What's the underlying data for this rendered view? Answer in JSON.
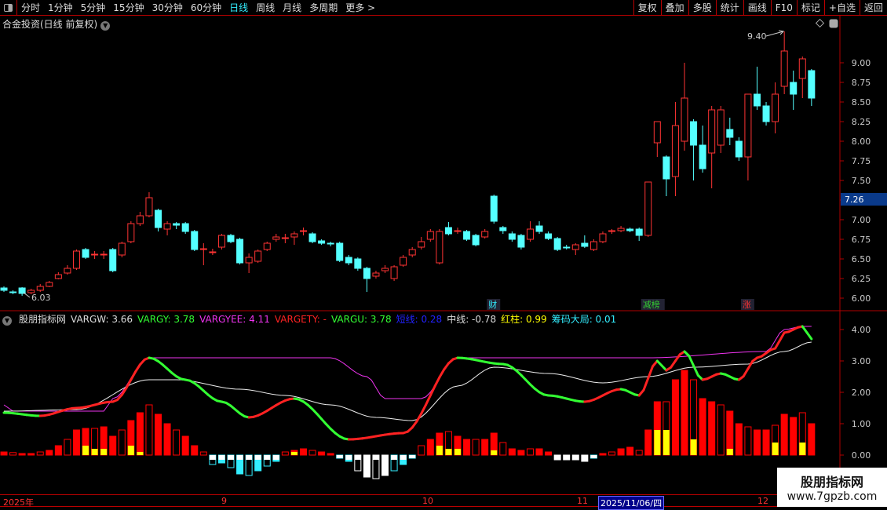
{
  "topbar": {
    "periods": [
      "分时",
      "1分钟",
      "5分钟",
      "15分钟",
      "30分钟",
      "60分钟",
      "日线",
      "周线",
      "月线",
      "多周期",
      "更多 >"
    ],
    "active": "日线",
    "right_buttons": [
      "复权",
      "叠加",
      "多股",
      "统计",
      "画线",
      "F10",
      "标记",
      "+自选",
      "返回"
    ]
  },
  "title": "合金投资(日线 前复权)",
  "price_axis": {
    "labels": [
      "9.00",
      "8.75",
      "8.50",
      "8.25",
      "8.00",
      "7.75",
      "7.50",
      "7.25",
      "7.00",
      "6.75",
      "6.50",
      "6.25",
      "6.00"
    ],
    "current": "7.26",
    "high_label": "9.40",
    "low_label": "6.03"
  },
  "markers": [
    {
      "text": "财",
      "color": "#3ef",
      "index": 54
    },
    {
      "text": "减榜",
      "color": "#3c3",
      "index": 71
    },
    {
      "text": "涨",
      "color": "#f33",
      "index": 82
    }
  ],
  "indicator": {
    "name": "股朋指标网",
    "items": [
      {
        "text": "VARGW: 3.66",
        "color": "#ddd"
      },
      {
        "text": "VARGY: 3.78",
        "color": "#3f3"
      },
      {
        "text": "VARGYEE: 4.11",
        "color": "#e3e"
      },
      {
        "text": "VARGETY: -",
        "color": "#f22"
      },
      {
        "text": "VARGU: 3.78",
        "color": "#3f3"
      },
      {
        "text": "短线: 0.28",
        "color": "#22f"
      },
      {
        "text": "中线: -0.78",
        "color": "#ddd"
      },
      {
        "text": "红柱: 0.99",
        "color": "#ff0"
      },
      {
        "text": "筹码大局: 0.01",
        "color": "#3ef"
      }
    ],
    "axis": [
      "4.00",
      "3.00",
      "2.00",
      "1.00",
      "0.00"
    ]
  },
  "dates": {
    "labels": [
      "2025年",
      "9",
      "10",
      "11",
      "2025/11/06/四",
      "12"
    ]
  },
  "watermark": {
    "line1": "股朋指标网",
    "line2": "www.7gpzb.com"
  },
  "colors": {
    "up": "#ff3333",
    "down": "#54ffff",
    "grid": "#b00000"
  },
  "chart_data": {
    "type": "candlestick",
    "price_range": [
      5.9,
      9.5
    ],
    "candles": [
      [
        6.13,
        6.1,
        6.15,
        6.08
      ],
      [
        6.08,
        6.07,
        6.1,
        6.05
      ],
      [
        6.13,
        6.06,
        6.14,
        6.03
      ],
      [
        6.07,
        6.1,
        6.12,
        6.05
      ],
      [
        6.1,
        6.15,
        6.18,
        6.08
      ],
      [
        6.15,
        6.2,
        6.22,
        6.14
      ],
      [
        6.25,
        6.3,
        6.33,
        6.24
      ],
      [
        6.32,
        6.38,
        6.42,
        6.3
      ],
      [
        6.38,
        6.6,
        6.62,
        6.36
      ],
      [
        6.62,
        6.52,
        6.64,
        6.5
      ],
      [
        6.55,
        6.56,
        6.6,
        6.5
      ],
      [
        6.55,
        6.56,
        6.6,
        6.5
      ],
      [
        6.62,
        6.35,
        6.64,
        6.33
      ],
      [
        6.55,
        6.7,
        6.72,
        6.52
      ],
      [
        6.72,
        6.95,
        6.98,
        6.7
      ],
      [
        6.95,
        7.05,
        7.1,
        6.92
      ],
      [
        7.05,
        7.28,
        7.35,
        7.03
      ],
      [
        7.12,
        6.9,
        7.14,
        6.85
      ],
      [
        6.88,
        6.95,
        6.98,
        6.8
      ],
      [
        6.95,
        6.93,
        6.97,
        6.88
      ],
      [
        6.95,
        6.85,
        6.97,
        6.82
      ],
      [
        6.85,
        6.62,
        6.87,
        6.6
      ],
      [
        6.62,
        6.63,
        6.7,
        6.42
      ],
      [
        6.58,
        6.59,
        6.63,
        6.55
      ],
      [
        6.65,
        6.8,
        6.82,
        6.62
      ],
      [
        6.8,
        6.72,
        6.82,
        6.7
      ],
      [
        6.75,
        6.45,
        6.77,
        6.43
      ],
      [
        6.45,
        6.52,
        6.57,
        6.32
      ],
      [
        6.47,
        6.6,
        6.62,
        6.45
      ],
      [
        6.62,
        6.7,
        6.72,
        6.6
      ],
      [
        6.75,
        6.78,
        6.82,
        6.72
      ],
      [
        6.76,
        6.77,
        6.82,
        6.7
      ],
      [
        6.78,
        6.82,
        6.85,
        6.68
      ],
      [
        6.85,
        6.86,
        6.9,
        6.8
      ],
      [
        6.82,
        6.72,
        6.84,
        6.7
      ],
      [
        6.73,
        6.7,
        6.75,
        6.68
      ],
      [
        6.7,
        6.69,
        6.72,
        6.66
      ],
      [
        6.7,
        6.48,
        6.72,
        6.46
      ],
      [
        6.52,
        6.45,
        6.55,
        6.42
      ],
      [
        6.5,
        6.38,
        6.52,
        6.35
      ],
      [
        6.38,
        6.25,
        6.4,
        6.08
      ],
      [
        6.28,
        6.32,
        6.35,
        6.25
      ],
      [
        6.35,
        6.38,
        6.42,
        6.32
      ],
      [
        6.25,
        6.4,
        6.42,
        6.22
      ],
      [
        6.42,
        6.52,
        6.55,
        6.4
      ],
      [
        6.55,
        6.62,
        6.65,
        6.52
      ],
      [
        6.65,
        6.72,
        6.78,
        6.62
      ],
      [
        6.75,
        6.85,
        6.88,
        6.72
      ],
      [
        6.45,
        6.85,
        6.88,
        6.43
      ],
      [
        6.9,
        6.82,
        6.97,
        6.8
      ],
      [
        6.85,
        6.86,
        6.9,
        6.82
      ],
      [
        6.85,
        6.75,
        6.87,
        6.73
      ],
      [
        6.8,
        6.68,
        6.82,
        6.66
      ],
      [
        6.78,
        6.85,
        6.88,
        6.76
      ],
      [
        7.3,
        6.98,
        7.32,
        6.95
      ],
      [
        6.9,
        6.86,
        6.92,
        6.82
      ],
      [
        6.82,
        6.75,
        6.85,
        6.72
      ],
      [
        6.8,
        6.65,
        6.82,
        6.62
      ],
      [
        6.75,
        6.88,
        6.98,
        6.72
      ],
      [
        6.92,
        6.85,
        6.98,
        6.82
      ],
      [
        6.82,
        6.76,
        6.85,
        6.74
      ],
      [
        6.76,
        6.62,
        6.78,
        6.6
      ],
      [
        6.65,
        6.64,
        6.68,
        6.62
      ],
      [
        6.62,
        6.68,
        6.7,
        6.55
      ],
      [
        6.7,
        6.66,
        6.8,
        6.64
      ],
      [
        6.62,
        6.72,
        6.75,
        6.6
      ],
      [
        6.72,
        6.82,
        6.85,
        6.7
      ],
      [
        6.85,
        6.86,
        6.88,
        6.82
      ],
      [
        6.86,
        6.89,
        6.92,
        6.84
      ],
      [
        6.88,
        6.86,
        6.9,
        6.84
      ],
      [
        6.88,
        6.8,
        6.9,
        6.73
      ],
      [
        6.8,
        7.48,
        7.48,
        6.78
      ],
      [
        7.98,
        8.25,
        8.25,
        7.8
      ],
      [
        7.8,
        7.52,
        7.82,
        7.3
      ],
      [
        7.55,
        8.2,
        8.5,
        7.3
      ],
      [
        8.0,
        8.55,
        9.0,
        7.88
      ],
      [
        8.25,
        7.95,
        8.28,
        7.5
      ],
      [
        7.95,
        7.65,
        8.2,
        7.6
      ],
      [
        7.85,
        8.4,
        8.45,
        7.4
      ],
      [
        7.95,
        8.4,
        8.45,
        7.85
      ],
      [
        8.15,
        8.05,
        8.3,
        7.95
      ],
      [
        8.0,
        7.8,
        8.05,
        7.75
      ],
      [
        7.8,
        8.6,
        8.6,
        7.5
      ],
      [
        8.6,
        8.45,
        8.95,
        8.4
      ],
      [
        8.45,
        8.25,
        8.5,
        8.2
      ],
      [
        8.25,
        8.6,
        8.75,
        8.1
      ],
      [
        8.7,
        9.15,
        9.4,
        8.6
      ],
      [
        8.75,
        8.6,
        8.9,
        8.4
      ],
      [
        8.8,
        9.05,
        9.08,
        8.55
      ],
      [
        8.9,
        8.55,
        8.92,
        8.45
      ]
    ],
    "indicator_range": [
      -0.75,
      4.4
    ],
    "bars": [
      0.1,
      0.08,
      0.05,
      0.05,
      0.1,
      0.15,
      0.3,
      0.5,
      0.8,
      0.85,
      0.85,
      0.9,
      0.6,
      0.8,
      1.1,
      1.35,
      1.6,
      1.3,
      1.0,
      0.8,
      0.6,
      0.3,
      0.1,
      -0.3,
      -0.25,
      -0.4,
      -0.6,
      -0.65,
      -0.5,
      -0.35,
      -0.2,
      0.1,
      0.15,
      0.2,
      0.15,
      0.1,
      0.05,
      -0.1,
      -0.2,
      -0.5,
      -0.7,
      -0.75,
      -0.65,
      -0.5,
      -0.3,
      -0.1,
      0.3,
      0.5,
      0.7,
      0.75,
      0.6,
      0.5,
      0.5,
      0.5,
      0.7,
      0.4,
      0.2,
      0.15,
      0.2,
      0.2,
      0.1,
      -0.15,
      -0.15,
      -0.15,
      -0.2,
      -0.1,
      0.05,
      0.1,
      0.2,
      0.25,
      0.15,
      0.8,
      1.7,
      1.7,
      2.4,
      2.7,
      2.4,
      1.8,
      1.7,
      1.6,
      1.4,
      1.0,
      0.9,
      0.8,
      0.8,
      0.95,
      1.3,
      1.2,
      1.35,
      1.0
    ],
    "yellow": [
      0,
      0,
      0,
      0,
      0,
      0,
      0,
      0,
      0,
      0.3,
      0.2,
      0.2,
      0,
      0,
      0.3,
      0.1,
      0,
      0,
      0,
      0,
      0,
      0,
      0,
      0,
      0,
      0,
      0,
      0,
      0,
      0,
      0,
      0,
      0.1,
      0,
      0,
      0,
      0,
      0,
      0,
      0,
      0,
      0,
      0,
      0,
      0,
      0,
      0,
      0,
      0.3,
      0.2,
      0.2,
      0,
      0,
      0,
      0.15,
      0,
      0,
      0,
      0,
      0,
      0,
      0,
      0,
      0,
      0,
      0,
      0,
      0,
      0,
      0,
      0,
      0,
      0.8,
      0.8,
      0,
      0,
      0.5,
      0,
      0,
      0,
      0.2,
      0,
      0,
      0,
      0,
      0.4,
      0,
      0,
      0.4,
      0
    ],
    "series": [
      {
        "name": "VARGY",
        "keypoints": [
          [
            0,
            1.35
          ],
          [
            4,
            1.25
          ],
          [
            8,
            1.5
          ],
          [
            12,
            1.7
          ],
          [
            16,
            3.1
          ],
          [
            20,
            2.4
          ],
          [
            24,
            1.7
          ],
          [
            27,
            1.2
          ],
          [
            32,
            1.8
          ],
          [
            38,
            0.5
          ],
          [
            44,
            0.7
          ],
          [
            50,
            3.1
          ],
          [
            55,
            2.9
          ],
          [
            60,
            1.9
          ],
          [
            64,
            1.7
          ],
          [
            68,
            2.1
          ],
          [
            70,
            1.9
          ],
          [
            72,
            3.0
          ],
          [
            73,
            2.7
          ],
          [
            75,
            3.3
          ],
          [
            77,
            2.4
          ],
          [
            79,
            2.6
          ],
          [
            81,
            2.4
          ],
          [
            83,
            3.1
          ],
          [
            85,
            3.4
          ],
          [
            86,
            3.9
          ],
          [
            88,
            4.1
          ],
          [
            89,
            3.7
          ]
        ]
      },
      {
        "name": "VARGW",
        "keypoints": [
          [
            0,
            1.4
          ],
          [
            8,
            1.45
          ],
          [
            16,
            2.4
          ],
          [
            19,
            2.4
          ],
          [
            26,
            2.1
          ],
          [
            31,
            1.9
          ],
          [
            36,
            1.6
          ],
          [
            41,
            1.2
          ],
          [
            45,
            1.1
          ],
          [
            50,
            2.2
          ],
          [
            54,
            2.8
          ],
          [
            60,
            2.6
          ],
          [
            66,
            2.3
          ],
          [
            71,
            2.5
          ],
          [
            76,
            2.8
          ],
          [
            82,
            2.9
          ],
          [
            86,
            3.3
          ],
          [
            89,
            3.6
          ]
        ]
      },
      {
        "name": "VARGYEE",
        "keypoints": [
          [
            0,
            1.6
          ],
          [
            1,
            1.4
          ],
          [
            11,
            1.4
          ],
          [
            12,
            1.8
          ],
          [
            16,
            3.1
          ],
          [
            36,
            3.1
          ],
          [
            40,
            2.5
          ],
          [
            42,
            1.8
          ],
          [
            46,
            1.8
          ],
          [
            50,
            3.1
          ],
          [
            71,
            3.1
          ],
          [
            84,
            3.3
          ],
          [
            86,
            4.0
          ],
          [
            88,
            4.1
          ],
          [
            89,
            4.1
          ]
        ]
      }
    ]
  }
}
